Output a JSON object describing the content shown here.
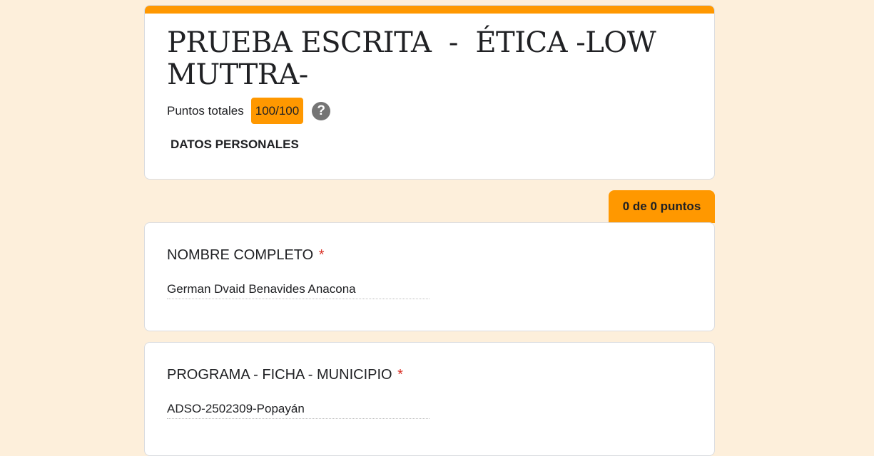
{
  "header": {
    "title": "PRUEBA ESCRITA  -  ÉTICA -LOW MUTTRA-",
    "points_label": "Puntos totales",
    "points_value": "100/100",
    "help_icon": "?",
    "section_label": "DATOS PERSONALES",
    "accent_color": "#ff9800"
  },
  "score_tab": {
    "label": "0 de 0 puntos"
  },
  "questions": [
    {
      "title": "NOMBRE COMPLETO",
      "required_marker": "*",
      "answer": "German Dvaid Benavides Anacona"
    },
    {
      "title": "PROGRAMA - FICHA - MUNICIPIO",
      "required_marker": "*",
      "answer": "ADSO-2502309-Popayán"
    }
  ]
}
